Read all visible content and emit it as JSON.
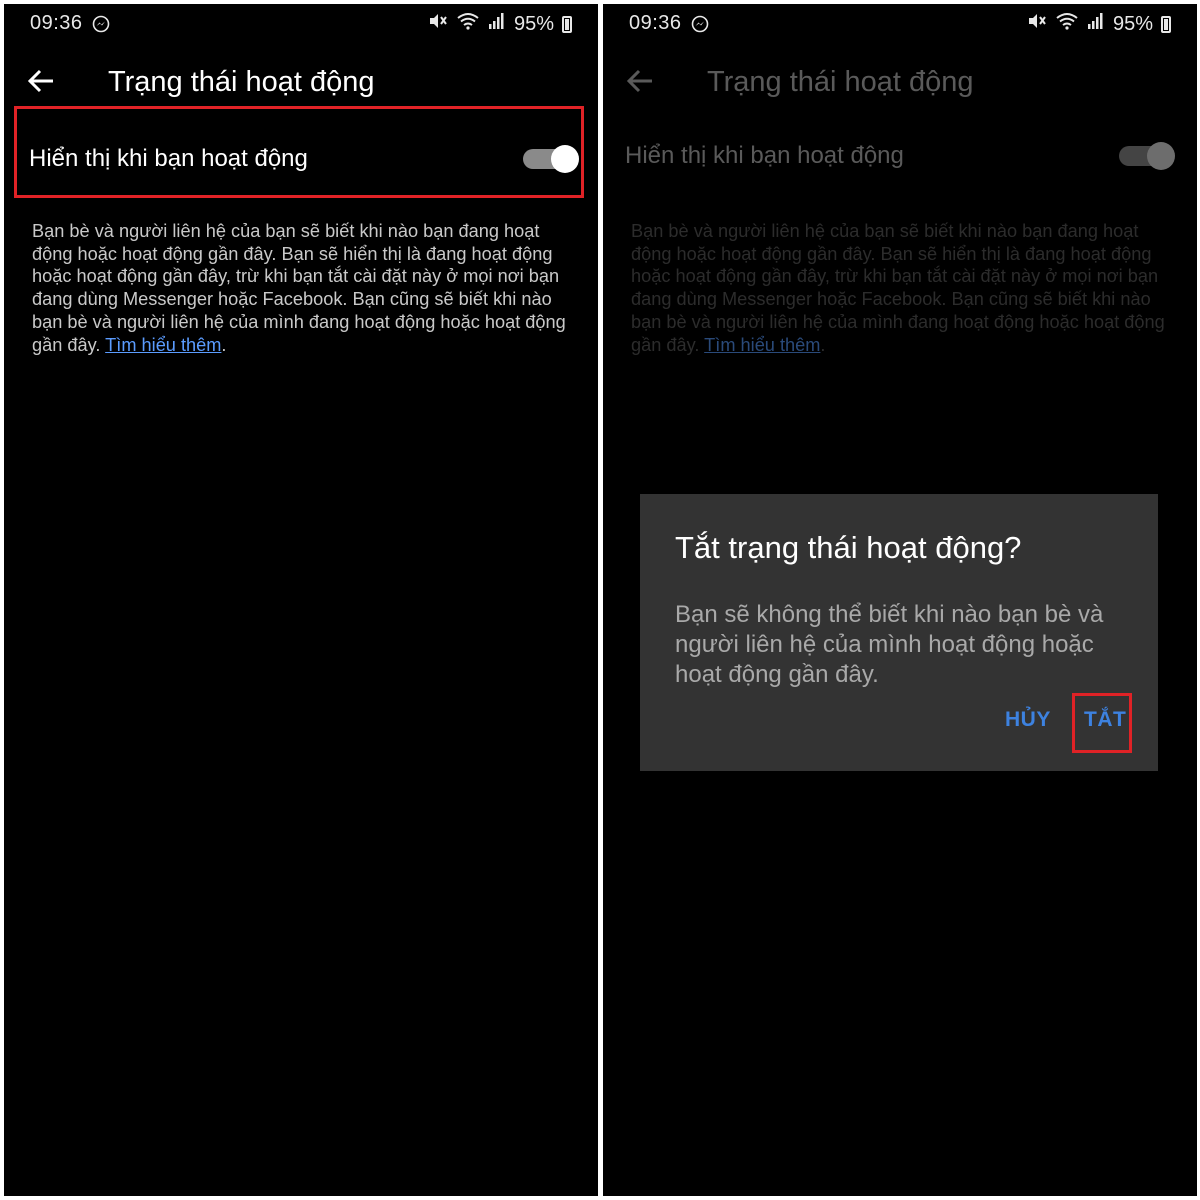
{
  "status": {
    "time": "09:36",
    "battery": "95%"
  },
  "header": {
    "title": "Trạng thái hoạt động"
  },
  "setting": {
    "label": "Hiển thị khi bạn hoạt động",
    "enabled": true
  },
  "description": {
    "text": "Bạn bè và người liên hệ của bạn sẽ biết khi nào bạn đang hoạt động hoặc hoạt động gần đây. Bạn sẽ hiển thị là đang hoạt động hoặc hoạt động gần đây, trừ khi bạn tắt cài đặt này ở mọi nơi bạn đang dùng Messenger hoặc Facebook. Bạn cũng sẽ biết khi nào bạn bè và người liên hệ của mình đang hoạt động hoặc hoạt động gần đây.",
    "link": "Tìm hiểu thêm",
    "link_suffix": "."
  },
  "dialog": {
    "title": "Tắt trạng thái hoạt động?",
    "body": "Bạn sẽ không thể biết khi nào bạn bè và người liên hệ của mình hoạt động hoặc hoạt động gần đây.",
    "cancel": "HỦY",
    "confirm": "TẮT"
  },
  "colors": {
    "background": "#000000",
    "highlight": "#e02226",
    "link": "#5b9cff",
    "dialog_button": "#3d82e0",
    "dialog_bg": "#333333"
  },
  "icons": {
    "back": "arrow-left-icon",
    "messenger": "messenger-icon",
    "mute": "mute-icon",
    "wifi": "wifi-icon",
    "signal": "signal-icon",
    "battery": "battery-icon"
  }
}
